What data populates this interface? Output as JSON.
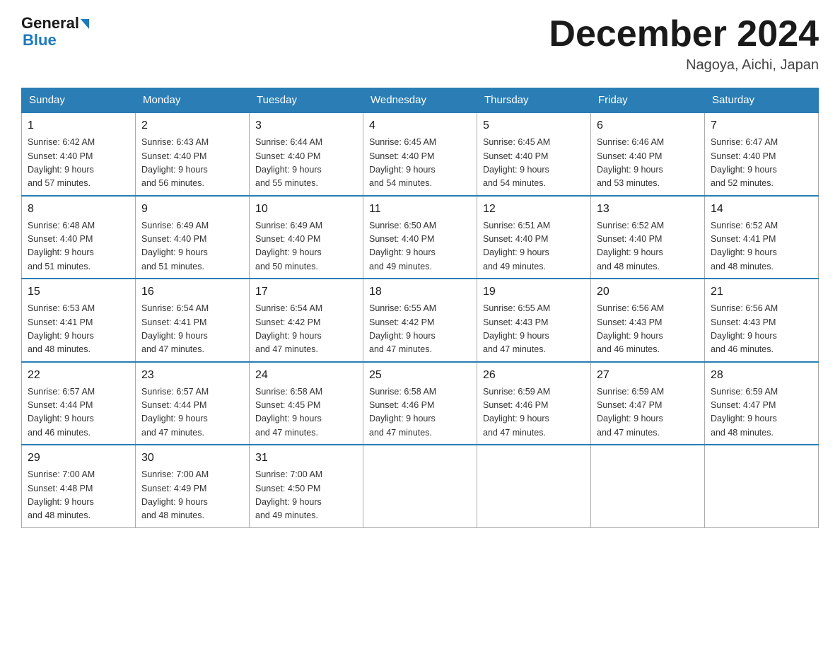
{
  "header": {
    "logo_general": "General",
    "logo_blue": "Blue",
    "month_title": "December 2024",
    "location": "Nagoya, Aichi, Japan"
  },
  "days_of_week": [
    "Sunday",
    "Monday",
    "Tuesday",
    "Wednesday",
    "Thursday",
    "Friday",
    "Saturday"
  ],
  "weeks": [
    [
      {
        "date": "1",
        "sunrise": "Sunrise: 6:42 AM",
        "sunset": "Sunset: 4:40 PM",
        "daylight": "Daylight: 9 hours and 57 minutes."
      },
      {
        "date": "2",
        "sunrise": "Sunrise: 6:43 AM",
        "sunset": "Sunset: 4:40 PM",
        "daylight": "Daylight: 9 hours and 56 minutes."
      },
      {
        "date": "3",
        "sunrise": "Sunrise: 6:44 AM",
        "sunset": "Sunset: 4:40 PM",
        "daylight": "Daylight: 9 hours and 55 minutes."
      },
      {
        "date": "4",
        "sunrise": "Sunrise: 6:45 AM",
        "sunset": "Sunset: 4:40 PM",
        "daylight": "Daylight: 9 hours and 54 minutes."
      },
      {
        "date": "5",
        "sunrise": "Sunrise: 6:45 AM",
        "sunset": "Sunset: 4:40 PM",
        "daylight": "Daylight: 9 hours and 54 minutes."
      },
      {
        "date": "6",
        "sunrise": "Sunrise: 6:46 AM",
        "sunset": "Sunset: 4:40 PM",
        "daylight": "Daylight: 9 hours and 53 minutes."
      },
      {
        "date": "7",
        "sunrise": "Sunrise: 6:47 AM",
        "sunset": "Sunset: 4:40 PM",
        "daylight": "Daylight: 9 hours and 52 minutes."
      }
    ],
    [
      {
        "date": "8",
        "sunrise": "Sunrise: 6:48 AM",
        "sunset": "Sunset: 4:40 PM",
        "daylight": "Daylight: 9 hours and 51 minutes."
      },
      {
        "date": "9",
        "sunrise": "Sunrise: 6:49 AM",
        "sunset": "Sunset: 4:40 PM",
        "daylight": "Daylight: 9 hours and 51 minutes."
      },
      {
        "date": "10",
        "sunrise": "Sunrise: 6:49 AM",
        "sunset": "Sunset: 4:40 PM",
        "daylight": "Daylight: 9 hours and 50 minutes."
      },
      {
        "date": "11",
        "sunrise": "Sunrise: 6:50 AM",
        "sunset": "Sunset: 4:40 PM",
        "daylight": "Daylight: 9 hours and 49 minutes."
      },
      {
        "date": "12",
        "sunrise": "Sunrise: 6:51 AM",
        "sunset": "Sunset: 4:40 PM",
        "daylight": "Daylight: 9 hours and 49 minutes."
      },
      {
        "date": "13",
        "sunrise": "Sunrise: 6:52 AM",
        "sunset": "Sunset: 4:40 PM",
        "daylight": "Daylight: 9 hours and 48 minutes."
      },
      {
        "date": "14",
        "sunrise": "Sunrise: 6:52 AM",
        "sunset": "Sunset: 4:41 PM",
        "daylight": "Daylight: 9 hours and 48 minutes."
      }
    ],
    [
      {
        "date": "15",
        "sunrise": "Sunrise: 6:53 AM",
        "sunset": "Sunset: 4:41 PM",
        "daylight": "Daylight: 9 hours and 48 minutes."
      },
      {
        "date": "16",
        "sunrise": "Sunrise: 6:54 AM",
        "sunset": "Sunset: 4:41 PM",
        "daylight": "Daylight: 9 hours and 47 minutes."
      },
      {
        "date": "17",
        "sunrise": "Sunrise: 6:54 AM",
        "sunset": "Sunset: 4:42 PM",
        "daylight": "Daylight: 9 hours and 47 minutes."
      },
      {
        "date": "18",
        "sunrise": "Sunrise: 6:55 AM",
        "sunset": "Sunset: 4:42 PM",
        "daylight": "Daylight: 9 hours and 47 minutes."
      },
      {
        "date": "19",
        "sunrise": "Sunrise: 6:55 AM",
        "sunset": "Sunset: 4:43 PM",
        "daylight": "Daylight: 9 hours and 47 minutes."
      },
      {
        "date": "20",
        "sunrise": "Sunrise: 6:56 AM",
        "sunset": "Sunset: 4:43 PM",
        "daylight": "Daylight: 9 hours and 46 minutes."
      },
      {
        "date": "21",
        "sunrise": "Sunrise: 6:56 AM",
        "sunset": "Sunset: 4:43 PM",
        "daylight": "Daylight: 9 hours and 46 minutes."
      }
    ],
    [
      {
        "date": "22",
        "sunrise": "Sunrise: 6:57 AM",
        "sunset": "Sunset: 4:44 PM",
        "daylight": "Daylight: 9 hours and 46 minutes."
      },
      {
        "date": "23",
        "sunrise": "Sunrise: 6:57 AM",
        "sunset": "Sunset: 4:44 PM",
        "daylight": "Daylight: 9 hours and 47 minutes."
      },
      {
        "date": "24",
        "sunrise": "Sunrise: 6:58 AM",
        "sunset": "Sunset: 4:45 PM",
        "daylight": "Daylight: 9 hours and 47 minutes."
      },
      {
        "date": "25",
        "sunrise": "Sunrise: 6:58 AM",
        "sunset": "Sunset: 4:46 PM",
        "daylight": "Daylight: 9 hours and 47 minutes."
      },
      {
        "date": "26",
        "sunrise": "Sunrise: 6:59 AM",
        "sunset": "Sunset: 4:46 PM",
        "daylight": "Daylight: 9 hours and 47 minutes."
      },
      {
        "date": "27",
        "sunrise": "Sunrise: 6:59 AM",
        "sunset": "Sunset: 4:47 PM",
        "daylight": "Daylight: 9 hours and 47 minutes."
      },
      {
        "date": "28",
        "sunrise": "Sunrise: 6:59 AM",
        "sunset": "Sunset: 4:47 PM",
        "daylight": "Daylight: 9 hours and 48 minutes."
      }
    ],
    [
      {
        "date": "29",
        "sunrise": "Sunrise: 7:00 AM",
        "sunset": "Sunset: 4:48 PM",
        "daylight": "Daylight: 9 hours and 48 minutes."
      },
      {
        "date": "30",
        "sunrise": "Sunrise: 7:00 AM",
        "sunset": "Sunset: 4:49 PM",
        "daylight": "Daylight: 9 hours and 48 minutes."
      },
      {
        "date": "31",
        "sunrise": "Sunrise: 7:00 AM",
        "sunset": "Sunset: 4:50 PM",
        "daylight": "Daylight: 9 hours and 49 minutes."
      },
      null,
      null,
      null,
      null
    ]
  ]
}
